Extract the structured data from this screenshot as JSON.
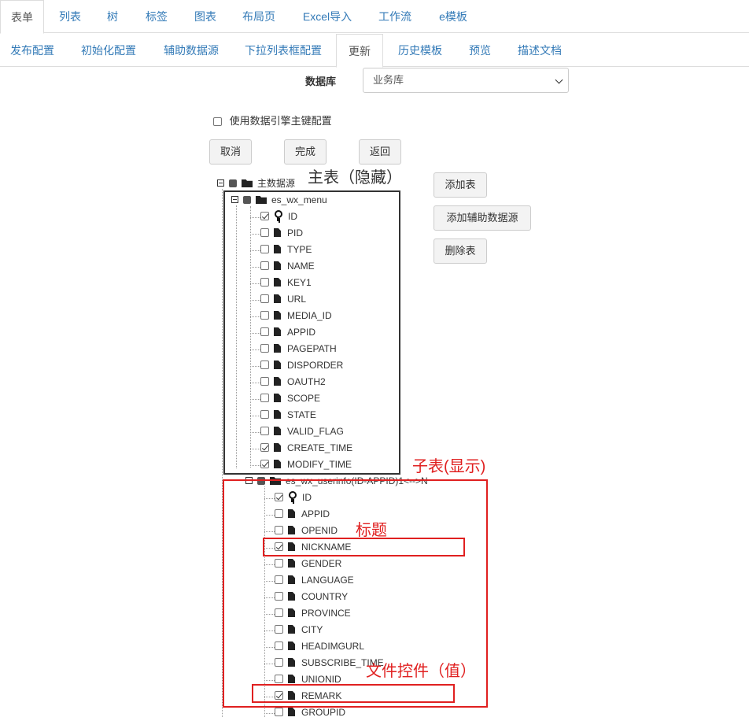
{
  "top_tabs": [
    "表单",
    "列表",
    "树",
    "标签",
    "图表",
    "布局页",
    "Excel导入",
    "工作流",
    "e模板"
  ],
  "sub_tabs": [
    "发布配置",
    "初始化配置",
    "辅助数据源",
    "下拉列表框配置",
    "更新",
    "历史模板",
    "预览",
    "描述文档"
  ],
  "database": {
    "label": "数据库",
    "selected": "业务库"
  },
  "use_engine_pk": {
    "label": "使用数据引擎主键配置",
    "checked": false
  },
  "actions": {
    "cancel": "取消",
    "finish": "完成",
    "back": "返回"
  },
  "side_buttons": {
    "add_table": "添加表",
    "add_aux": "添加辅助数据源",
    "delete_table": "删除表"
  },
  "tree": {
    "root": "主数据源",
    "main_table": {
      "name": "es_wx_menu",
      "fields": [
        {
          "name": "ID",
          "checked": true,
          "key": true
        },
        {
          "name": "PID",
          "checked": false
        },
        {
          "name": "TYPE",
          "checked": false
        },
        {
          "name": "NAME",
          "checked": false
        },
        {
          "name": "KEY1",
          "checked": false
        },
        {
          "name": "URL",
          "checked": false
        },
        {
          "name": "MEDIA_ID",
          "checked": false
        },
        {
          "name": "APPID",
          "checked": false
        },
        {
          "name": "PAGEPATH",
          "checked": false
        },
        {
          "name": "DISPORDER",
          "checked": false
        },
        {
          "name": "OAUTH2",
          "checked": false
        },
        {
          "name": "SCOPE",
          "checked": false
        },
        {
          "name": "STATE",
          "checked": false
        },
        {
          "name": "VALID_FLAG",
          "checked": false
        },
        {
          "name": "CREATE_TIME",
          "checked": true
        },
        {
          "name": "MODIFY_TIME",
          "checked": true
        }
      ]
    },
    "sub_table": {
      "name": "es_wx_userinfo(ID-APPID)1<-->N",
      "fields": [
        {
          "name": "ID",
          "checked": true,
          "key": true
        },
        {
          "name": "APPID",
          "checked": false
        },
        {
          "name": "OPENID",
          "checked": false
        },
        {
          "name": "NICKNAME",
          "checked": true
        },
        {
          "name": "GENDER",
          "checked": false
        },
        {
          "name": "LANGUAGE",
          "checked": false
        },
        {
          "name": "COUNTRY",
          "checked": false
        },
        {
          "name": "PROVINCE",
          "checked": false
        },
        {
          "name": "CITY",
          "checked": false
        },
        {
          "name": "HEADIMGURL",
          "checked": false
        },
        {
          "name": "SUBSCRIBE_TIME",
          "checked": false
        },
        {
          "name": "UNIONID",
          "checked": false
        },
        {
          "name": "REMARK",
          "checked": true
        },
        {
          "name": "GROUPID",
          "checked": false
        }
      ]
    }
  },
  "annotations": {
    "main_hidden": "主表（隐藏）",
    "sub_shown": "子表(显示)",
    "title": "标题",
    "file_control": "文件控件（值）",
    "colors": {
      "dark": "#333333",
      "red": "#e02020"
    }
  }
}
